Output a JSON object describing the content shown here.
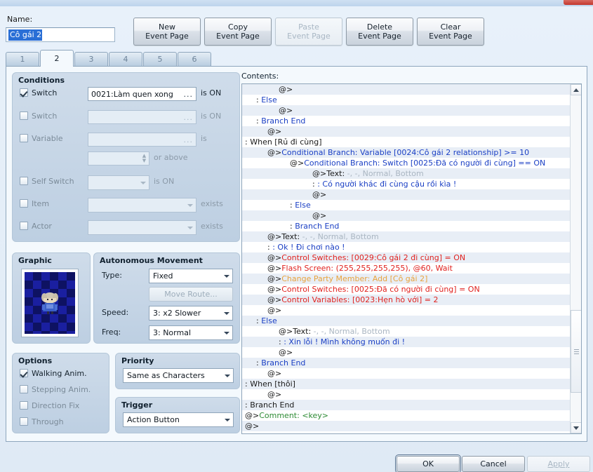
{
  "window": {
    "close_icon": "close-icon"
  },
  "name": {
    "label": "Name:",
    "value": "Cô gái 2"
  },
  "toolbar": {
    "buttons": [
      {
        "line1": "New",
        "line2": "Event Page",
        "disabled": false
      },
      {
        "line1": "Copy",
        "line2": "Event Page",
        "disabled": false
      },
      {
        "line1": "Paste",
        "line2": "Event Page",
        "disabled": true
      },
      {
        "line1": "Delete",
        "line2": "Event Page",
        "disabled": false
      },
      {
        "line1": "Clear",
        "line2": "Event Page",
        "disabled": false
      }
    ]
  },
  "tabs": {
    "items": [
      "1",
      "2",
      "3",
      "4",
      "5",
      "6"
    ],
    "active_index": 1
  },
  "conditions": {
    "title": "Conditions",
    "rows": [
      {
        "label": "Switch",
        "checked": true,
        "value": "0021:Làm quen xong",
        "suffix": "is ON",
        "dots": "..."
      },
      {
        "label": "Switch",
        "checked": false,
        "value": "",
        "suffix": "is ON",
        "dots": "..."
      },
      {
        "label": "Variable",
        "checked": false,
        "value": "",
        "suffix": "is",
        "dots": "..."
      },
      {
        "label": "Self Switch",
        "checked": false,
        "value": "",
        "suffix": "is ON",
        "dots": ""
      },
      {
        "label": "Item",
        "checked": false,
        "value": "",
        "suffix": "exists",
        "dots": ""
      },
      {
        "label": "Actor",
        "checked": false,
        "value": "",
        "suffix": "exists",
        "dots": ""
      }
    ],
    "variable_spin_value": "",
    "variable_spin_suffix": "or above"
  },
  "graphic": {
    "title": "Graphic"
  },
  "movement": {
    "title": "Autonomous Movement",
    "type_label": "Type:",
    "type_value": "Fixed",
    "move_route_label": "Move Route...",
    "speed_label": "Speed:",
    "speed_value": "3: x2 Slower",
    "freq_label": "Freq:",
    "freq_value": "3: Normal"
  },
  "options": {
    "title": "Options",
    "items": [
      {
        "label": "Walking Anim.",
        "checked": true
      },
      {
        "label": "Stepping Anim.",
        "checked": false
      },
      {
        "label": "Direction Fix",
        "checked": false
      },
      {
        "label": "Through",
        "checked": false
      }
    ]
  },
  "priority": {
    "title": "Priority",
    "value": "Same as Characters"
  },
  "trigger": {
    "title": "Trigger",
    "value": "Action Button"
  },
  "contents": {
    "label": "Contents:",
    "scrollbar": {
      "up_icon": "scroll-up-icon",
      "down_icon": "scroll-down-icon",
      "thumb_icon": "scroll-thumb"
    },
    "rows": [
      {
        "indent": 6,
        "prefix": "@>",
        "text": "",
        "color": "#1a1a1a"
      },
      {
        "indent": 2,
        "prefix": ":",
        "text": "Else",
        "color": "#1a3fc4"
      },
      {
        "indent": 6,
        "prefix": "@>",
        "text": "",
        "color": "#1a1a1a"
      },
      {
        "indent": 2,
        "prefix": ":",
        "text": "Branch End",
        "color": "#1a3fc4"
      },
      {
        "indent": 4,
        "prefix": "@>",
        "text": "",
        "color": "#1a1a1a"
      },
      {
        "indent": 0,
        "prefix": ":",
        "text": "When [Rủ đi cùng]",
        "color": "#1a1a1a"
      },
      {
        "indent": 4,
        "prefix": "@>",
        "text": "Conditional Branch: Variable [0024:Cô gái 2 relationship] >= 10",
        "color": "#1a3fc4"
      },
      {
        "indent": 8,
        "prefix": "@>",
        "text": "Conditional Branch: Switch [0025:Đã có người đi cùng] == ON",
        "color": "#1a3fc4"
      },
      {
        "indent": 12,
        "prefix": "@>",
        "text": "Text: -, -, Normal, Bottom",
        "color": "#1a1a1a",
        "dim_from": 5
      },
      {
        "indent": 12,
        "prefix": ":",
        "text": "      : Có người khác đi cùng cậu rồi kìa !",
        "color": "#1a3fc4"
      },
      {
        "indent": 12,
        "prefix": "@>",
        "text": "",
        "color": "#1a1a1a"
      },
      {
        "indent": 8,
        "prefix": ":",
        "text": "Else",
        "color": "#1a3fc4"
      },
      {
        "indent": 12,
        "prefix": "@>",
        "text": "",
        "color": "#1a1a1a"
      },
      {
        "indent": 8,
        "prefix": ":",
        "text": "Branch End",
        "color": "#1a3fc4"
      },
      {
        "indent": 4,
        "prefix": "@>",
        "text": "Text: -, -, Normal, Bottom",
        "color": "#1a1a1a",
        "dim_from": 5
      },
      {
        "indent": 4,
        "prefix": ":",
        "text": "      : Ok ! Đi chơi nào !",
        "color": "#1a3fc4"
      },
      {
        "indent": 4,
        "prefix": "@>",
        "text": "Control Switches: [0029:Cô gái 2 đi cùng] = ON",
        "color": "#e0221f"
      },
      {
        "indent": 4,
        "prefix": "@>",
        "text": "Flash Screen: (255,255,255,255), @60, Wait",
        "color": "#e0221f"
      },
      {
        "indent": 4,
        "prefix": "@>",
        "text": "Change Party Member: Add [Cô gái 2]",
        "color": "#e8a33d"
      },
      {
        "indent": 4,
        "prefix": "@>",
        "text": "Control Switches: [0025:Đã có người đi cùng] = ON",
        "color": "#e0221f"
      },
      {
        "indent": 4,
        "prefix": "@>",
        "text": "Control Variables: [0023:Hẹn hò với] = 2",
        "color": "#e0221f"
      },
      {
        "indent": 4,
        "prefix": "@>",
        "text": "",
        "color": "#1a1a1a"
      },
      {
        "indent": 2,
        "prefix": ":",
        "text": "Else",
        "color": "#1a3fc4"
      },
      {
        "indent": 6,
        "prefix": "@>",
        "text": "Text: -, -, Normal, Bottom",
        "color": "#1a1a1a",
        "dim_from": 5
      },
      {
        "indent": 6,
        "prefix": ":",
        "text": "      : Xin lỗi ! Mình không muốn đi !",
        "color": "#1a3fc4"
      },
      {
        "indent": 6,
        "prefix": "@>",
        "text": "",
        "color": "#1a1a1a"
      },
      {
        "indent": 2,
        "prefix": ":",
        "text": "Branch End",
        "color": "#1a3fc4"
      },
      {
        "indent": 4,
        "prefix": "@>",
        "text": "",
        "color": "#1a1a1a"
      },
      {
        "indent": 0,
        "prefix": ":",
        "text": "When [thôi]",
        "color": "#1a1a1a"
      },
      {
        "indent": 4,
        "prefix": "@>",
        "text": "",
        "color": "#1a1a1a"
      },
      {
        "indent": 0,
        "prefix": ":",
        "text": "Branch End",
        "color": "#1a1a1a"
      },
      {
        "indent": 0,
        "prefix": "@>",
        "text": "Comment: <key>",
        "color": "#2e8b35"
      },
      {
        "indent": 0,
        "prefix": "@>",
        "text": "",
        "color": "#1a1a1a"
      }
    ]
  },
  "footer": {
    "ok": "OK",
    "cancel": "Cancel",
    "apply": "Apply",
    "apply_disabled": true
  }
}
